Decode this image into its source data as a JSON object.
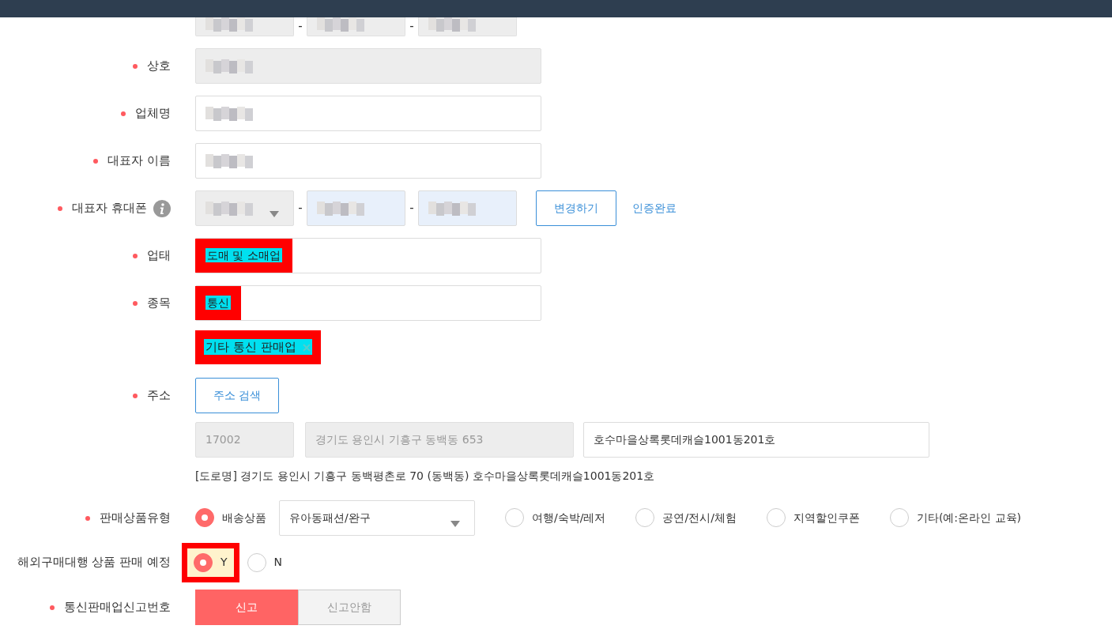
{
  "rows": [
    {
      "kind": "triple",
      "separator": "-",
      "inputs": [
        {
          "disabled": true,
          "redacted": true
        },
        {
          "disabled": true,
          "redacted": true
        },
        {
          "disabled": true,
          "redacted": true
        }
      ]
    },
    {
      "kind": "text",
      "label": "상호",
      "required": true,
      "disabled": true,
      "redacted": true
    },
    {
      "kind": "text",
      "label": "업체명",
      "required": true,
      "redacted": true
    },
    {
      "kind": "text",
      "label": "대표자 이름",
      "required": true,
      "redacted": true
    },
    {
      "kind": "phone",
      "label": "대표자 휴대폰",
      "required": true,
      "info": true,
      "separator": "-",
      "inputs": [
        {
          "disabled": true,
          "redacted": true,
          "dropdown": true
        },
        {
          "autofilled": true,
          "redacted": true
        },
        {
          "autofilled": true,
          "redacted": true
        }
      ],
      "button": "변경하기",
      "status": "인증완료"
    },
    {
      "kind": "text",
      "label": "업태",
      "required": true,
      "value": "도매 및 소매업",
      "highlighted": true
    },
    {
      "kind": "text",
      "label": "종목",
      "required": true,
      "value": "통신",
      "highlighted": true
    },
    {
      "kind": "tag",
      "tag": "기타 통신 판매업",
      "highlighted": true
    },
    {
      "kind": "address",
      "label": "주소",
      "required": true,
      "button": "주소 검색",
      "postal": "17002",
      "address1": "경기도 용인시 기흥구 동백동 653",
      "address2": "호수마을상록롯데캐슬1001동201호",
      "road": "[도로명] 경기도 용인시 기흥구 동백평촌로 70 (동백동) 호수마을상록롯데캐슬1001동201호"
    },
    {
      "kind": "radios",
      "label": "판매상품유형",
      "required": true,
      "options": [
        {
          "label": "배송상품",
          "selected": true,
          "select": "유아동패션/완구"
        },
        {
          "label": "여행/숙박/레저",
          "selected": false
        },
        {
          "label": "공연/전시/체험",
          "selected": false
        },
        {
          "label": "지역할인쿠폰",
          "selected": false
        },
        {
          "label": "기타(예:온라인 교육)",
          "selected": false
        }
      ]
    },
    {
      "kind": "yn",
      "label": "해외구매대행 상품 판매 예정",
      "highlighted": true,
      "options": [
        {
          "label": "Y",
          "selected": true
        },
        {
          "label": "N",
          "selected": false
        }
      ]
    },
    {
      "kind": "segment",
      "label": "통신판매업신고번호",
      "required": true,
      "options": [
        {
          "label": "신고",
          "selected": true
        },
        {
          "label": "신고안함",
          "selected": false
        }
      ]
    }
  ]
}
